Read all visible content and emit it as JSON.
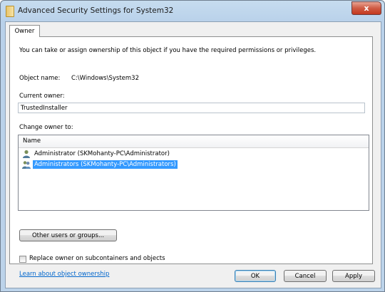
{
  "window": {
    "title": "Advanced Security Settings for System32",
    "close_glyph": "x"
  },
  "tabs": [
    {
      "label": "Owner"
    }
  ],
  "owner_tab": {
    "intro": "You can take or assign ownership of this object if you have the required permissions or privileges.",
    "object_name_label": "Object name:",
    "object_name_value": "C:\\Windows\\System32",
    "current_owner_label": "Current owner:",
    "current_owner_value": "TrustedInstaller",
    "change_owner_label": "Change owner to:",
    "list_header": "Name",
    "list_items": [
      {
        "label": "Administrator (SKMohanty-PC\\Administrator)",
        "icon": "user-icon",
        "selected": false
      },
      {
        "label": "Administrators (SKMohanty-PC\\Administrators)",
        "icon": "group-icon",
        "selected": true
      }
    ],
    "other_users_button": "Other users or groups...",
    "replace_owner_label": "Replace owner on subcontainers and objects",
    "replace_owner_checked": false,
    "learn_link": "Learn about object ownership"
  },
  "footer": {
    "ok": "OK",
    "cancel": "Cancel",
    "apply": "Apply"
  },
  "colors": {
    "selection": "#3399ff",
    "link": "#0066cc",
    "close_button": "#c4391f"
  }
}
